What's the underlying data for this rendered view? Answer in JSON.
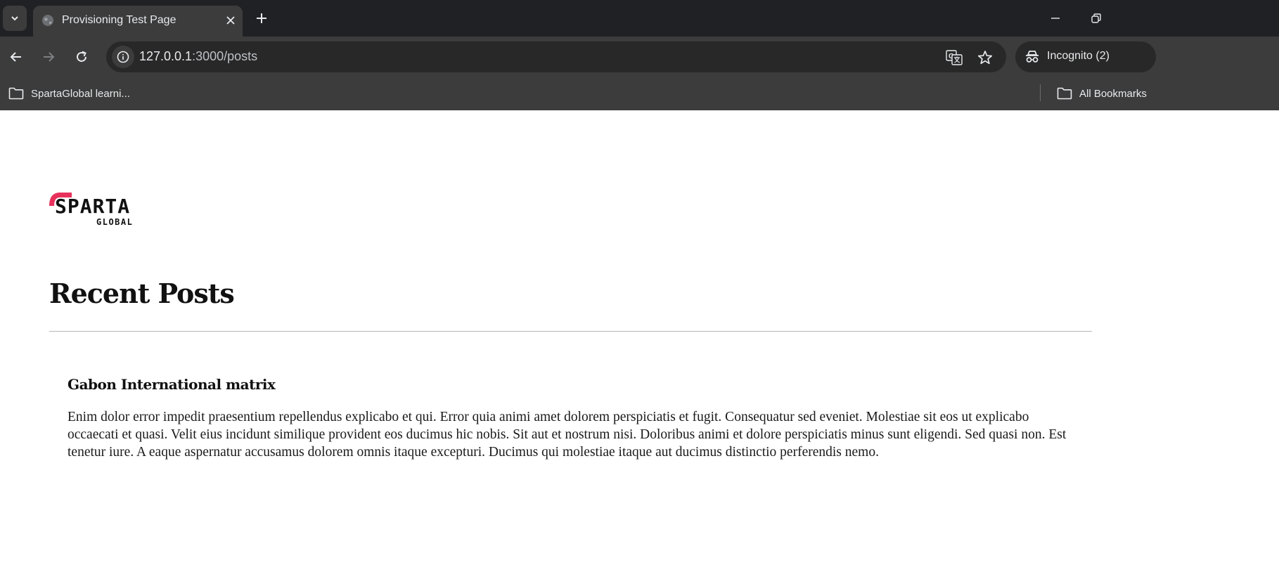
{
  "browser": {
    "tab": {
      "title": "Provisioning Test Page"
    },
    "address_bar": {
      "host": "127.0.0.1",
      "path": ":3000/posts"
    },
    "profile": {
      "label": "Incognito (2)"
    },
    "bookmarks": [
      {
        "label": "SpartaGlobal learni..."
      },
      {
        "label": "All Bookmarks"
      }
    ]
  },
  "page": {
    "logo": {
      "brand": "SPARTA",
      "sub": "GLOBAL"
    },
    "heading": "Recent Posts",
    "posts": [
      {
        "title": "Gabon International matrix",
        "body": "Enim dolor error impedit praesentium repellendus explicabo et qui. Error quia animi amet dolorem perspiciatis et fugit. Consequatur sed eveniet. Molestiae sit eos ut explicabo occaecati et quasi. Velit eius incidunt similique provident eos ducimus hic nobis. Sit aut et nostrum nisi. Doloribus animi et dolore perspiciatis minus sunt eligendi. Sed quasi non. Est tenetur iure. A eaque aspernatur accusamus dolorem omnis itaque excepturi. Ducimus qui molestiae itaque aut ducimus distinctio perferendis nemo."
      }
    ]
  },
  "colors": {
    "brand_accent": "#e8315b",
    "chrome_dark": "#202124",
    "chrome_toolbar": "#3c3c3c"
  }
}
